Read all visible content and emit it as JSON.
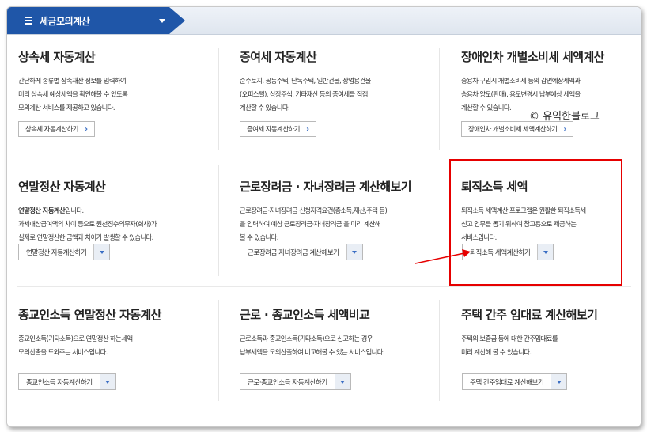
{
  "header": {
    "title": "세금모의계산"
  },
  "watermark": "© 유익한블로그",
  "cards": [
    {
      "title": "상속세 자동계산",
      "desc": [
        "간단하게 종류별 상속재산 정보를 입력하여",
        "미리 상속세 예상세액을 확인해볼 수 있도록",
        "모의계산 서비스를 제공하고 있습니다."
      ],
      "button": "상속세 자동계산하기"
    },
    {
      "title": "증여세 자동계산",
      "desc": [
        "순수토지, 공동주택, 단독주택, 일반건물, 상업용건물",
        "(오피스텔), 상장주식, 기타재산 등의 증여세를 직접",
        "계산할 수 있습니다."
      ],
      "button": "증여세 자동계산하기"
    },
    {
      "title": "장애인차 개별소비세 세액계산",
      "desc": [
        "승용차 구입시 개별소비세 등의 감면예상세액과",
        "승용차 양도(판매), 용도변경시 납부예상 세액을",
        "계산할 수 있습니다."
      ],
      "button": "장애인차 개별소비세 세액계산하기"
    },
    {
      "title": "연말정산 자동계산",
      "desc_bold": "연말정산 자동계산",
      "desc_first_rest": "입니다.",
      "desc": [
        "과세대상급여액의 차이 등으로 원천징수의무자(회사)가",
        "실제로 연말정산한 금액과 차이가 발생할 수 있습니다."
      ],
      "button": "연말정산 자동계산하기"
    },
    {
      "title": "근로장려금 · 자녀장려금 계산해보기",
      "desc": [
        "근로장려금·자녀장려금 신청자격요건(총소득,재산,주택 등)",
        "을 입력하여 예상 근로장려금·자녀장려금 을 미리 계산해",
        "볼 수 있습니다."
      ],
      "button": "근로장려금·자녀장려금 계산해보기"
    },
    {
      "title": "퇴직소득 세액",
      "desc": [
        "퇴직소득 세액계산 프로그램은 원활한 퇴직소득세",
        "신고 업무를 돕기 위하여 참고용으로 제공하는",
        "서비스입니다."
      ],
      "button": "퇴직소득 세액계산하기"
    },
    {
      "title": "종교인소득 연말정산 자동계산",
      "desc": [
        "종교인소득(기타소득)으로 연말정산 하는세액",
        "모의산출을 도와주는 서비스입니다."
      ],
      "button": "종교인소득 자동계산하기"
    },
    {
      "title": "근로 · 종교인소득 세액비교",
      "desc": [
        "근로소득과 종교인소득(기타소득)으로 신고하는 경우",
        "납부세액을 모의산출하여 비교해볼 수 있는 서비스입니다."
      ],
      "button": "근로·종교인소득 자동계산하기"
    },
    {
      "title": "주택 간주 임대료 계산해보기",
      "desc": [
        "주택의 보증금 등에 대한 간주임대료를",
        "미리 계산해 볼 수 있습니다."
      ],
      "button": "주택 간주임대료 계산해보기"
    }
  ],
  "colors": {
    "brand": "#1f56a8",
    "highlight": "#e60000"
  }
}
